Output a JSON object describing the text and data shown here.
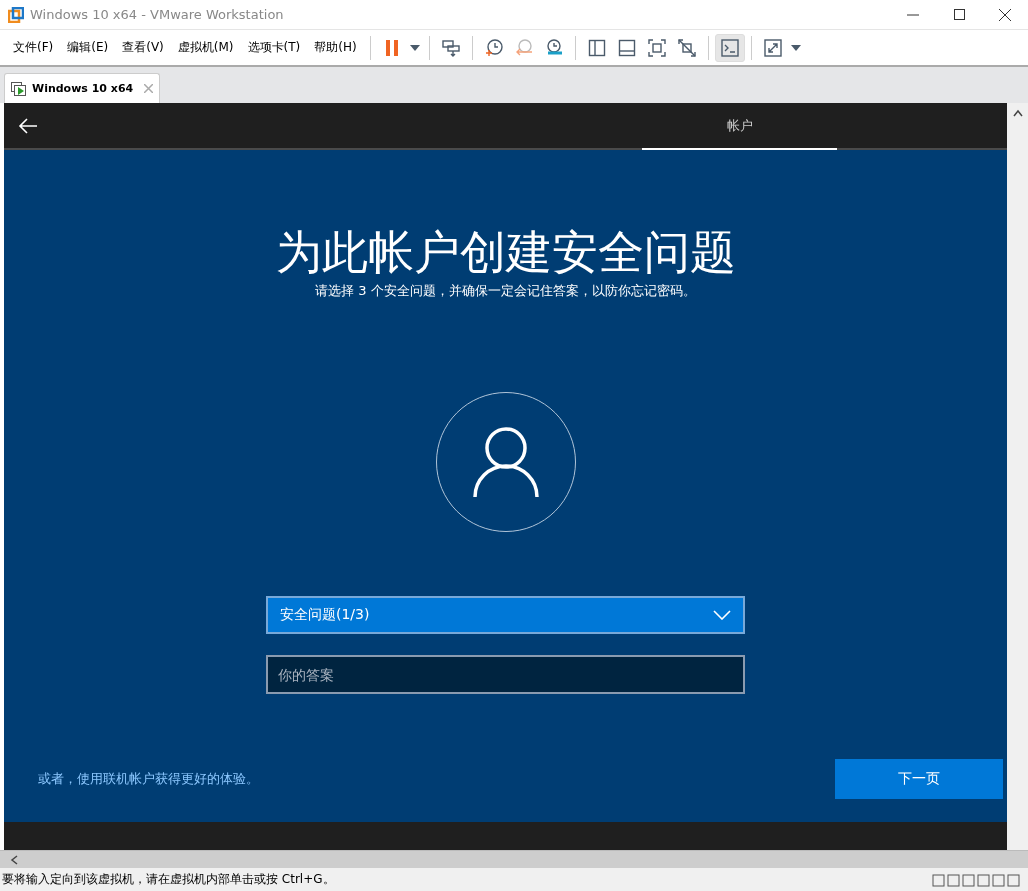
{
  "window": {
    "title": "Windows 10 x64 - VMware Workstation"
  },
  "menu": [
    "文件(F)",
    "编辑(E)",
    "查看(V)",
    "虚拟机(M)",
    "选项卡(T)",
    "帮助(H)"
  ],
  "toolbar": [
    {
      "kind": "pause"
    },
    {
      "kind": "caret"
    },
    {
      "kind": "sep"
    },
    {
      "kind": "send"
    },
    {
      "kind": "sep"
    },
    {
      "kind": "snapshot"
    },
    {
      "kind": "revert"
    },
    {
      "kind": "manage"
    },
    {
      "kind": "sep"
    },
    {
      "kind": "sidebar"
    },
    {
      "kind": "thumbs"
    },
    {
      "kind": "fit"
    },
    {
      "kind": "nofit"
    },
    {
      "kind": "sep"
    },
    {
      "kind": "console",
      "on": true
    },
    {
      "kind": "sep"
    },
    {
      "kind": "fullscreen"
    },
    {
      "kind": "caret"
    }
  ],
  "tabs": [
    {
      "label": "Windows 10 x64",
      "selected": true
    }
  ],
  "guest": {
    "steps": [
      {
        "label": "帐户",
        "selected": true
      }
    ],
    "heading": "为此帐户创建安全问题",
    "subtitle": "请选择 3 个安全问题，并确保一定会记住答案，以防你忘记密码。",
    "question_dropdown": {
      "value": "安全问题(1/3)"
    },
    "answer_field": {
      "placeholder": "你的答案"
    },
    "online_link": "或者，使用联机帐户获得更好的体验。",
    "next_button": "下一页"
  },
  "status_bar": {
    "text": "要将输入定向到该虚拟机，请在虚拟机内部单击或按 Ctrl+G。"
  }
}
